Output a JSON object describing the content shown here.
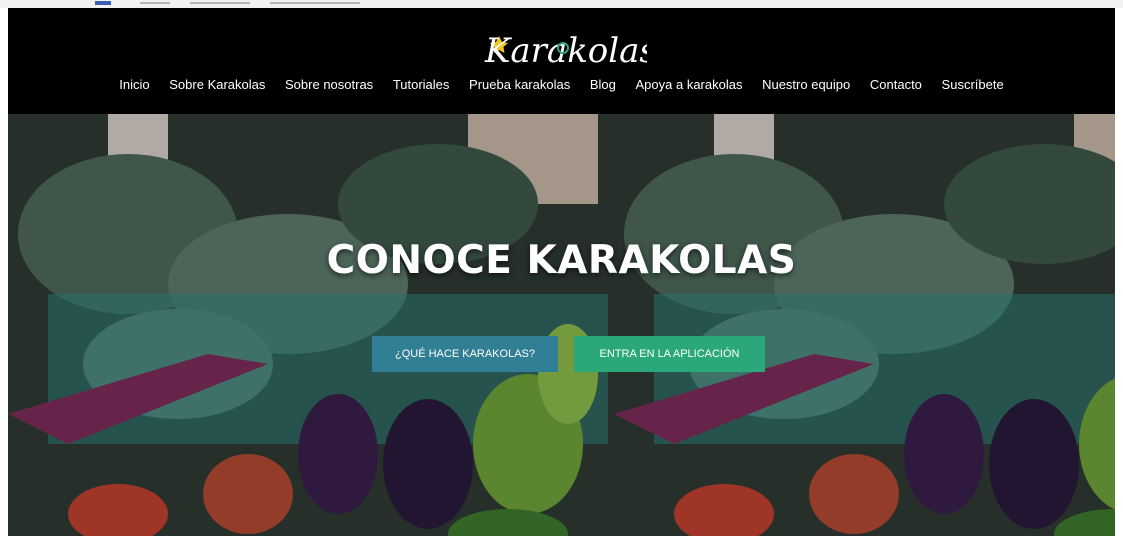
{
  "brand": {
    "logo_text": "Karakolas"
  },
  "nav": {
    "items": [
      "Inicio",
      "Sobre Karakolas",
      "Sobre nosotras",
      "Tutoriales",
      "Prueba karakolas",
      "Blog",
      "Apoya a karakolas",
      "Nuestro equipo",
      "Contacto",
      "Suscríbete"
    ]
  },
  "hero": {
    "title": "CONOCE KARAKOLAS",
    "button_primary": "¿QUÉ HACE KARAKOLAS?",
    "button_secondary": "ENTRA EN LA APLICACIÓN"
  },
  "colors": {
    "header_bg": "#000000",
    "button_primary": "#317f94",
    "button_secondary": "#2aa87a",
    "logo_star": "#f2c51c"
  }
}
